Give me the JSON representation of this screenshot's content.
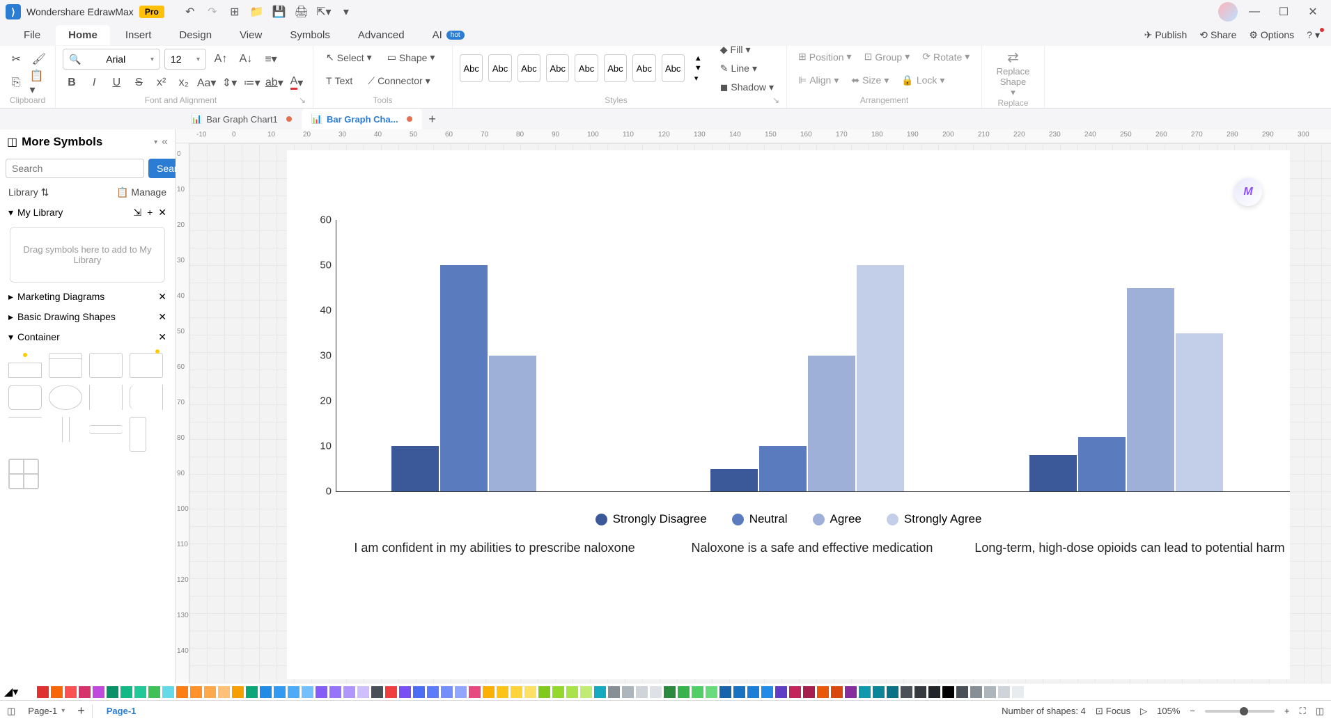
{
  "app": {
    "title": "Wondershare EdrawMax",
    "badge": "Pro"
  },
  "menubar": {
    "items": [
      "File",
      "Home",
      "Insert",
      "Design",
      "View",
      "Symbols",
      "Advanced",
      "AI"
    ],
    "active": "Home",
    "ai_badge": "hot",
    "right": {
      "publish": "Publish",
      "share": "Share",
      "options": "Options"
    }
  },
  "ribbon": {
    "clipboard_label": "Clipboard",
    "font": {
      "family": "Arial",
      "size": "12"
    },
    "font_align_label": "Font and Alignment",
    "tools": {
      "select": "Select",
      "shape": "Shape",
      "text": "Text",
      "connector": "Connector",
      "label": "Tools"
    },
    "styles": {
      "swatch": "Abc",
      "label": "Styles",
      "fill": "Fill",
      "line": "Line",
      "shadow": "Shadow"
    },
    "arrangement": {
      "position": "Position",
      "align": "Align",
      "group": "Group",
      "size": "Size",
      "rotate": "Rotate",
      "lock": "Lock",
      "label": "Arrangement"
    },
    "replace": {
      "line1": "Replace",
      "line2": "Shape",
      "label": "Replace"
    }
  },
  "doc_tabs": {
    "tab1": "Bar Graph Chart1",
    "tab2": "Bar Graph Cha..."
  },
  "sidebar": {
    "title": "More Symbols",
    "search_placeholder": "Search",
    "search_btn": "Search",
    "library": "Library",
    "manage": "Manage",
    "my_library": "My Library",
    "dropzone": "Drag symbols here to add to My Library",
    "sections": {
      "marketing": "Marketing Diagrams",
      "basic": "Basic Drawing Shapes",
      "container": "Container"
    }
  },
  "ruler_h": [
    "-10",
    "0",
    "10",
    "20",
    "30",
    "40",
    "50",
    "60",
    "70",
    "80",
    "90",
    "100",
    "110",
    "120",
    "130",
    "140",
    "150",
    "160",
    "170",
    "180",
    "190",
    "200",
    "210",
    "220",
    "230",
    "240",
    "250",
    "260",
    "270",
    "280",
    "290",
    "300"
  ],
  "ruler_v": [
    "0",
    "10",
    "20",
    "30",
    "40",
    "50",
    "60",
    "70",
    "80",
    "90",
    "100",
    "110",
    "120",
    "130",
    "140"
  ],
  "chart_data": {
    "type": "bar",
    "ylim": [
      0,
      60
    ],
    "y_ticks": [
      0,
      10,
      20,
      30,
      40,
      50,
      60
    ],
    "categories": [
      "I am confident in my abilities to prescribe naloxone",
      "Naloxone is a safe and effective medication",
      "Long-term, high-dose opioids can lead to potential harm"
    ],
    "series": [
      {
        "name": "Strongly Disagree",
        "color": "#3b5998",
        "values": [
          10,
          5,
          8
        ]
      },
      {
        "name": "Neutral",
        "color": "#5b7bbf",
        "values": [
          50,
          10,
          12
        ]
      },
      {
        "name": "Agree",
        "color": "#9eb0d8",
        "values": [
          30,
          30,
          45
        ]
      },
      {
        "name": "Strongly Agree",
        "color": "#c3cee8",
        "values": [
          0,
          50,
          35
        ]
      }
    ]
  },
  "color_palette": [
    "#ffffff",
    "#e03131",
    "#f76707",
    "#fa5252",
    "#d6336c",
    "#be4bdb",
    "#099268",
    "#12b886",
    "#20c997",
    "#40c057",
    "#66d9e8",
    "#fd7e14",
    "#ff922b",
    "#ffa94d",
    "#ffc078",
    "#f59f00",
    "#0ca678",
    "#228be6",
    "#339af0",
    "#4dabf7",
    "#74c0fc",
    "#845ef7",
    "#9775fa",
    "#b197fc",
    "#d0bfff",
    "#495057",
    "#f03e3e",
    "#7950f2",
    "#4c6ef5",
    "#5c7cfa",
    "#748ffc",
    "#91a7ff",
    "#e64980",
    "#fab005",
    "#fcc419",
    "#ffd43b",
    "#ffe066",
    "#82c91e",
    "#94d82d",
    "#a9e34b",
    "#c0eb75",
    "#15aabf",
    "#868e96",
    "#adb5bd",
    "#ced4da",
    "#dee2e6",
    "#2b8a3e",
    "#37b24d",
    "#51cf66",
    "#69db7c",
    "#1864ab",
    "#1971c2",
    "#1c7ed6",
    "#228be6",
    "#5f3dc4",
    "#c2255c",
    "#a61e4d",
    "#e8590c",
    "#d9480f",
    "#862e9c",
    "#1098ad",
    "#0c8599",
    "#0b7285",
    "#495057",
    "#343a40",
    "#212529",
    "#000000",
    "#495057",
    "#868e96",
    "#adb5bd",
    "#ced4da",
    "#e9ecef"
  ],
  "statusbar": {
    "page_select": "Page-1",
    "page_tab": "Page-1",
    "shapes": "Number of shapes: 4",
    "focus": "Focus",
    "zoom": "105%"
  }
}
